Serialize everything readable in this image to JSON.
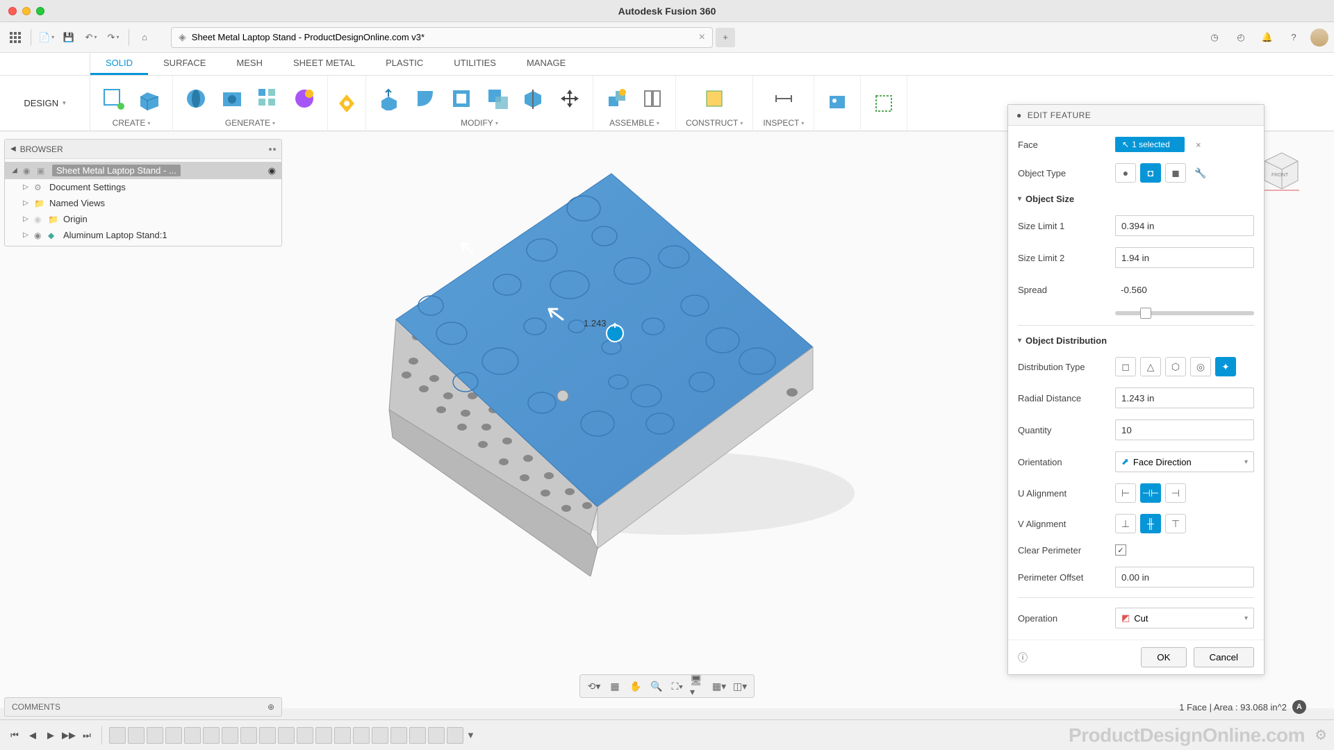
{
  "app_title": "Autodesk Fusion 360",
  "document": {
    "title": "Sheet Metal Laptop Stand - ProductDesignOnline.com v3*"
  },
  "workspace": "DESIGN",
  "ribbon_tabs": [
    "SOLID",
    "SURFACE",
    "MESH",
    "SHEET METAL",
    "PLASTIC",
    "UTILITIES",
    "MANAGE"
  ],
  "ribbon_groups": {
    "create": "CREATE",
    "generate": "GENERATE",
    "modify": "MODIFY",
    "assemble": "ASSEMBLE",
    "construct": "CONSTRUCT",
    "inspect": "INSPECT"
  },
  "browser": {
    "title": "BROWSER",
    "root": "Sheet Metal Laptop Stand - ...",
    "items": [
      {
        "label": "Document Settings"
      },
      {
        "label": "Named Views"
      },
      {
        "label": "Origin"
      },
      {
        "label": "Aluminum Laptop Stand:1"
      }
    ]
  },
  "panel": {
    "title": "EDIT FEATURE",
    "face_label": "Face",
    "face_selected": "1 selected",
    "object_type_label": "Object Type",
    "object_size_section": "Object Size",
    "size_limit_1_label": "Size Limit 1",
    "size_limit_1_value": "0.394 in",
    "size_limit_2_label": "Size Limit 2",
    "size_limit_2_value": "1.94 in",
    "spread_label": "Spread",
    "spread_value": "-0.560",
    "distribution_section": "Object Distribution",
    "distribution_type_label": "Distribution Type",
    "radial_distance_label": "Radial Distance",
    "radial_distance_value": "1.243 in",
    "quantity_label": "Quantity",
    "quantity_value": "10",
    "orientation_label": "Orientation",
    "orientation_value": "Face Direction",
    "u_align_label": "U Alignment",
    "v_align_label": "V Alignment",
    "clear_perimeter_label": "Clear Perimeter",
    "perimeter_offset_label": "Perimeter Offset",
    "perimeter_offset_value": "0.00 in",
    "operation_label": "Operation",
    "operation_value": "Cut",
    "ok": "OK",
    "cancel": "Cancel"
  },
  "canvas": {
    "dimension": "1.243"
  },
  "comments_label": "COMMENTS",
  "status": "1 Face | Area : 93.068 in^2",
  "watermark": "ProductDesignOnline.com"
}
